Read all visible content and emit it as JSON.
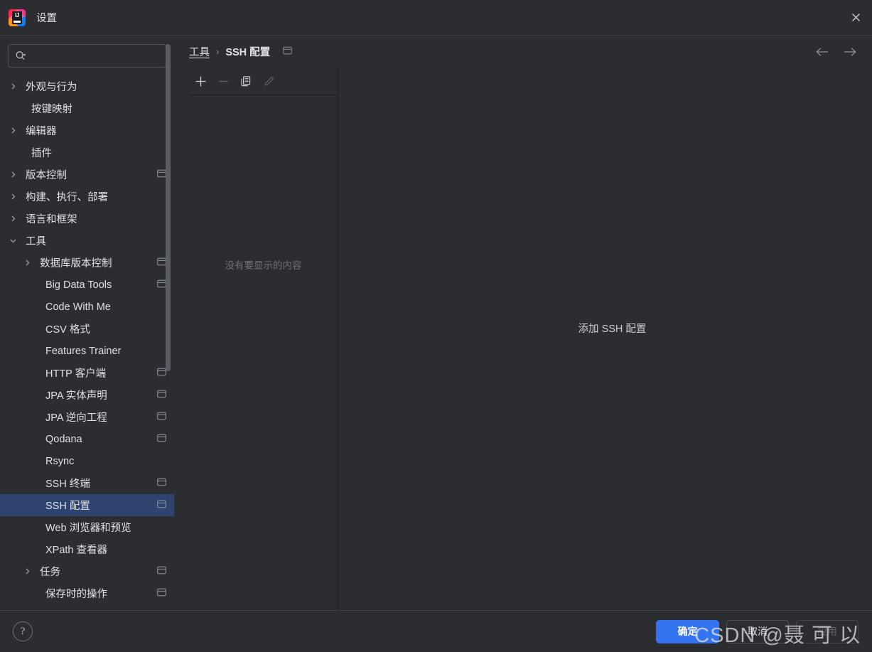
{
  "window": {
    "title": "设置",
    "app_icon": "intellij-idea-logo",
    "close_icon": "close-icon"
  },
  "search": {
    "icon": "search-icon",
    "value": "",
    "placeholder": ""
  },
  "sidebar": {
    "items": [
      {
        "label": "外观与行为",
        "level": 0,
        "arrow": "chevron-right",
        "badge": false,
        "selected": false
      },
      {
        "label": "按键映射",
        "level": 0,
        "arrow": "",
        "badge": false,
        "selected": false
      },
      {
        "label": "编辑器",
        "level": 0,
        "arrow": "chevron-right",
        "badge": false,
        "selected": false
      },
      {
        "label": "插件",
        "level": 0,
        "arrow": "",
        "badge": false,
        "selected": false
      },
      {
        "label": "版本控制",
        "level": 0,
        "arrow": "chevron-right",
        "badge": true,
        "selected": false
      },
      {
        "label": "构建、执行、部署",
        "level": 0,
        "arrow": "chevron-right",
        "badge": false,
        "selected": false
      },
      {
        "label": "语言和框架",
        "level": 0,
        "arrow": "chevron-right",
        "badge": false,
        "selected": false
      },
      {
        "label": "工具",
        "level": 0,
        "arrow": "chevron-down",
        "badge": false,
        "selected": false
      },
      {
        "label": "数据库版本控制",
        "level": 1,
        "arrow": "chevron-right",
        "badge": true,
        "selected": false
      },
      {
        "label": "Big Data Tools",
        "level": 1,
        "arrow": "",
        "badge": true,
        "selected": false
      },
      {
        "label": "Code With Me",
        "level": 1,
        "arrow": "",
        "badge": false,
        "selected": false
      },
      {
        "label": "CSV 格式",
        "level": 1,
        "arrow": "",
        "badge": false,
        "selected": false
      },
      {
        "label": "Features Trainer",
        "level": 1,
        "arrow": "",
        "badge": false,
        "selected": false
      },
      {
        "label": "HTTP 客户端",
        "level": 1,
        "arrow": "",
        "badge": true,
        "selected": false
      },
      {
        "label": "JPA 实体声明",
        "level": 1,
        "arrow": "",
        "badge": true,
        "selected": false
      },
      {
        "label": "JPA 逆向工程",
        "level": 1,
        "arrow": "",
        "badge": true,
        "selected": false
      },
      {
        "label": "Qodana",
        "level": 1,
        "arrow": "",
        "badge": true,
        "selected": false
      },
      {
        "label": "Rsync",
        "level": 1,
        "arrow": "",
        "badge": false,
        "selected": false
      },
      {
        "label": "SSH 终端",
        "level": 1,
        "arrow": "",
        "badge": true,
        "selected": false
      },
      {
        "label": "SSH 配置",
        "level": 1,
        "arrow": "",
        "badge": true,
        "selected": true
      },
      {
        "label": "Web 浏览器和预览",
        "level": 1,
        "arrow": "",
        "badge": false,
        "selected": false
      },
      {
        "label": "XPath 查看器",
        "level": 1,
        "arrow": "",
        "badge": false,
        "selected": false
      },
      {
        "label": "任务",
        "level": 1,
        "arrow": "chevron-right",
        "badge": true,
        "selected": false
      },
      {
        "label": "保存时的操作",
        "level": 1,
        "arrow": "",
        "badge": true,
        "selected": false
      }
    ]
  },
  "breadcrumb": {
    "root": "工具",
    "separator": "›",
    "leaf": "SSH 配置",
    "scope_icon": "project-scope-icon"
  },
  "nav": {
    "back_icon": "arrow-left-icon",
    "forward_icon": "arrow-right-icon"
  },
  "list_toolbar": {
    "add_label": "+",
    "remove_label": "−",
    "copy_icon": "copy-icon",
    "edit_icon": "pencil-icon"
  },
  "list_pane": {
    "empty_message": "没有要显示的内容"
  },
  "detail_pane": {
    "message": "添加 SSH 配置"
  },
  "footer": {
    "help_label": "?",
    "ok_label": "确定",
    "cancel_label": "取消",
    "apply_label": "应用"
  },
  "watermark": {
    "text": "CSDN @聂 可 以"
  },
  "colors": {
    "background": "#2b2d30",
    "selection": "#2e436e",
    "primary_button": "#3574f0",
    "border": "#1e1f22",
    "text": "#dfe1e5",
    "muted_text": "#6f737a"
  }
}
